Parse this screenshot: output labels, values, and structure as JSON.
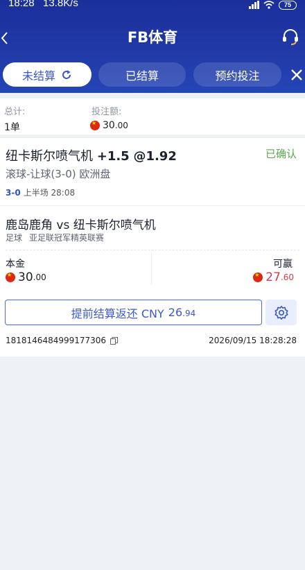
{
  "status_bar": {
    "time": "18:28",
    "rate": "13.8K/s",
    "battery": "75"
  },
  "header": {
    "title": "FB体育",
    "icons": {
      "back": "chevron-left-icon",
      "service": "headset-icon"
    }
  },
  "tabs": [
    {
      "label": "未结算",
      "active": true
    },
    {
      "label": "已结算",
      "active": false
    },
    {
      "label": "预约投注",
      "active": false
    }
  ],
  "summary": {
    "total_label": "总计:",
    "total_value": "1单",
    "stake_label": "投注额:",
    "stake_value_int": "30",
    "stake_value_dec": ".00"
  },
  "bet": {
    "selection": "纽卡斯尔喷气机",
    "handicap": "+1.5",
    "odds": "@1.92",
    "status": "已确认",
    "market": "滚球-让球(3-0) 欧洲盘",
    "score": "3-0",
    "period": "上半场 28:08",
    "match": "鹿岛鹿角 vs 纽卡斯尔喷气机",
    "sport": "足球",
    "league": "亚足联冠军精英联赛",
    "stake_label": "本金",
    "stake_int": "30",
    "stake_dec": ".00",
    "win_label": "可赢",
    "win_int": "27",
    "win_dec": ".60",
    "cashout_label": "提前结算返还 CNY",
    "cashout_int": "26",
    "cashout_dec": ".94",
    "bet_id": "1818146484999177306",
    "datetime": "2026/09/15 18:28:28"
  },
  "colors": {
    "header": "#213aa8",
    "accent": "#3b59c9",
    "confirmed": "#5fa84f",
    "win": "#d43b41"
  }
}
